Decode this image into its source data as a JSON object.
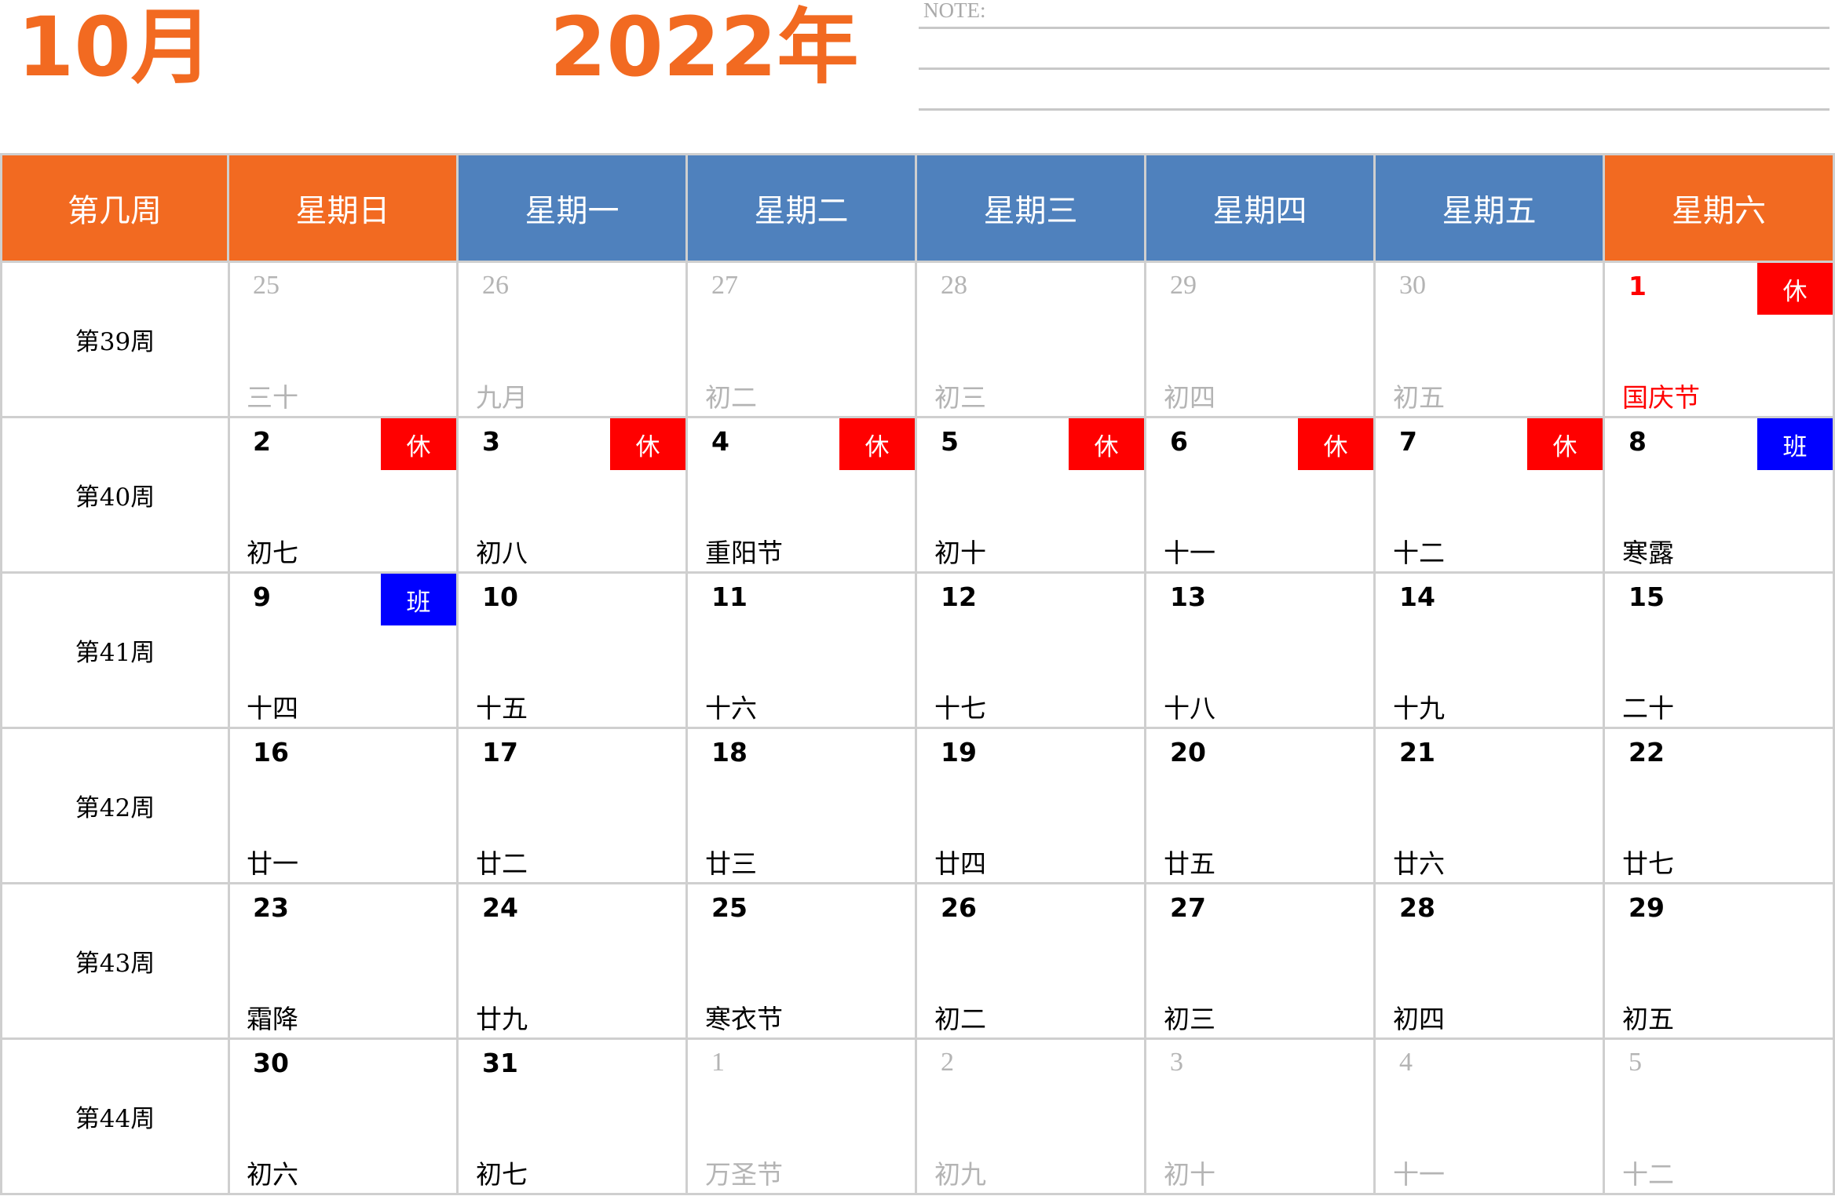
{
  "header": {
    "month": "10月",
    "year": "2022年",
    "note_label": "NOTE:"
  },
  "columns": [
    "第几周",
    "星期日",
    "星期一",
    "星期二",
    "星期三",
    "星期四",
    "星期五",
    "星期六"
  ],
  "colors": {
    "orange": "#f26a21",
    "blue": "#4f81bd",
    "rest": "#ff0000",
    "work": "#0000ff",
    "muted": "#b4b4b4"
  },
  "weeks": [
    {
      "label": "第39周",
      "days": [
        {
          "num": "25",
          "lunar": "三十",
          "other": true
        },
        {
          "num": "26",
          "lunar": "九月",
          "other": true
        },
        {
          "num": "27",
          "lunar": "初二",
          "other": true
        },
        {
          "num": "28",
          "lunar": "初三",
          "other": true
        },
        {
          "num": "29",
          "lunar": "初四",
          "other": true
        },
        {
          "num": "30",
          "lunar": "初五",
          "other": true
        },
        {
          "num": "1",
          "lunar": "国庆节",
          "holiday": true,
          "badge": "休",
          "badge_type": "rest"
        }
      ]
    },
    {
      "label": "第40周",
      "days": [
        {
          "num": "2",
          "lunar": "初七",
          "badge": "休",
          "badge_type": "rest"
        },
        {
          "num": "3",
          "lunar": "初八",
          "badge": "休",
          "badge_type": "rest"
        },
        {
          "num": "4",
          "lunar": "重阳节",
          "badge": "休",
          "badge_type": "rest"
        },
        {
          "num": "5",
          "lunar": "初十",
          "badge": "休",
          "badge_type": "rest"
        },
        {
          "num": "6",
          "lunar": "十一",
          "badge": "休",
          "badge_type": "rest"
        },
        {
          "num": "7",
          "lunar": "十二",
          "badge": "休",
          "badge_type": "rest"
        },
        {
          "num": "8",
          "lunar": "寒露",
          "badge": "班",
          "badge_type": "work"
        }
      ]
    },
    {
      "label": "第41周",
      "days": [
        {
          "num": "9",
          "lunar": "十四",
          "badge": "班",
          "badge_type": "work"
        },
        {
          "num": "10",
          "lunar": "十五"
        },
        {
          "num": "11",
          "lunar": "十六"
        },
        {
          "num": "12",
          "lunar": "十七"
        },
        {
          "num": "13",
          "lunar": "十八"
        },
        {
          "num": "14",
          "lunar": "十九"
        },
        {
          "num": "15",
          "lunar": "二十"
        }
      ]
    },
    {
      "label": "第42周",
      "days": [
        {
          "num": "16",
          "lunar": "廿一"
        },
        {
          "num": "17",
          "lunar": "廿二"
        },
        {
          "num": "18",
          "lunar": "廿三"
        },
        {
          "num": "19",
          "lunar": "廿四"
        },
        {
          "num": "20",
          "lunar": "廿五"
        },
        {
          "num": "21",
          "lunar": "廿六"
        },
        {
          "num": "22",
          "lunar": "廿七"
        }
      ]
    },
    {
      "label": "第43周",
      "days": [
        {
          "num": "23",
          "lunar": "霜降"
        },
        {
          "num": "24",
          "lunar": "廿九"
        },
        {
          "num": "25",
          "lunar": "寒衣节"
        },
        {
          "num": "26",
          "lunar": "初二"
        },
        {
          "num": "27",
          "lunar": "初三"
        },
        {
          "num": "28",
          "lunar": "初四"
        },
        {
          "num": "29",
          "lunar": "初五"
        }
      ]
    },
    {
      "label": "第44周",
      "days": [
        {
          "num": "30",
          "lunar": "初六"
        },
        {
          "num": "31",
          "lunar": "初七"
        },
        {
          "num": "1",
          "lunar": "万圣节",
          "other": true
        },
        {
          "num": "2",
          "lunar": "初九",
          "other": true
        },
        {
          "num": "3",
          "lunar": "初十",
          "other": true
        },
        {
          "num": "4",
          "lunar": "十一",
          "other": true
        },
        {
          "num": "5",
          "lunar": "十二",
          "other": true
        }
      ]
    }
  ]
}
